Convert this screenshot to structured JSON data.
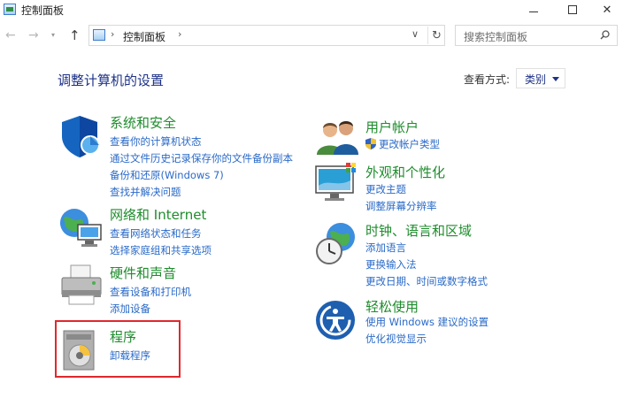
{
  "window": {
    "title": "控制面板",
    "minimize_glyph": "─",
    "close_glyph": "✕"
  },
  "nav": {
    "back_glyph": "←",
    "forward_glyph": "→",
    "recent_glyph": "▾",
    "up_glyph": "↑",
    "breadcrumb_sep": "›",
    "breadcrumb": "控制面板",
    "dropdown_glyph": "∨",
    "refresh_glyph": "↻",
    "search_placeholder": "搜索控制面板"
  },
  "header": {
    "title": "调整计算机的设置",
    "viewby_label": "查看方式:",
    "viewby_value": "类别"
  },
  "categories": {
    "system": {
      "title": "系统和安全",
      "links": [
        "查看你的计算机状态",
        "通过文件历史记录保存你的文件备份副本",
        "备份和还原(Windows 7)",
        "查找并解决问题"
      ]
    },
    "network": {
      "title": "网络和 Internet",
      "links": [
        "查看网络状态和任务",
        "选择家庭组和共享选项"
      ]
    },
    "hardware": {
      "title": "硬件和声音",
      "links": [
        "查看设备和打印机",
        "添加设备"
      ]
    },
    "programs": {
      "title": "程序",
      "links": [
        "卸载程序"
      ]
    },
    "users": {
      "title": "用户帐户",
      "links": [
        "更改帐户类型"
      ]
    },
    "appearance": {
      "title": "外观和个性化",
      "links": [
        "更改主题",
        "调整屏幕分辨率"
      ]
    },
    "clock": {
      "title": "时钟、语言和区域",
      "links": [
        "添加语言",
        "更换输入法",
        "更改日期、时间或数字格式"
      ]
    },
    "ease": {
      "title": "轻松使用",
      "links": [
        "使用 Windows 建议的设置",
        "优化视觉显示"
      ]
    }
  },
  "colors": {
    "category_title": "#1e8c2c",
    "link": "#2a6ac8",
    "heading": "#1e3287",
    "highlight_border": "#e0282e"
  },
  "icons": {
    "system": "security-shield-icon",
    "network": "network-globe-icon",
    "hardware": "printer-icon",
    "programs": "program-disc-icon",
    "users": "user-accounts-icon",
    "appearance": "display-personalization-icon",
    "clock": "clock-globe-icon",
    "ease": "ease-of-access-icon"
  }
}
